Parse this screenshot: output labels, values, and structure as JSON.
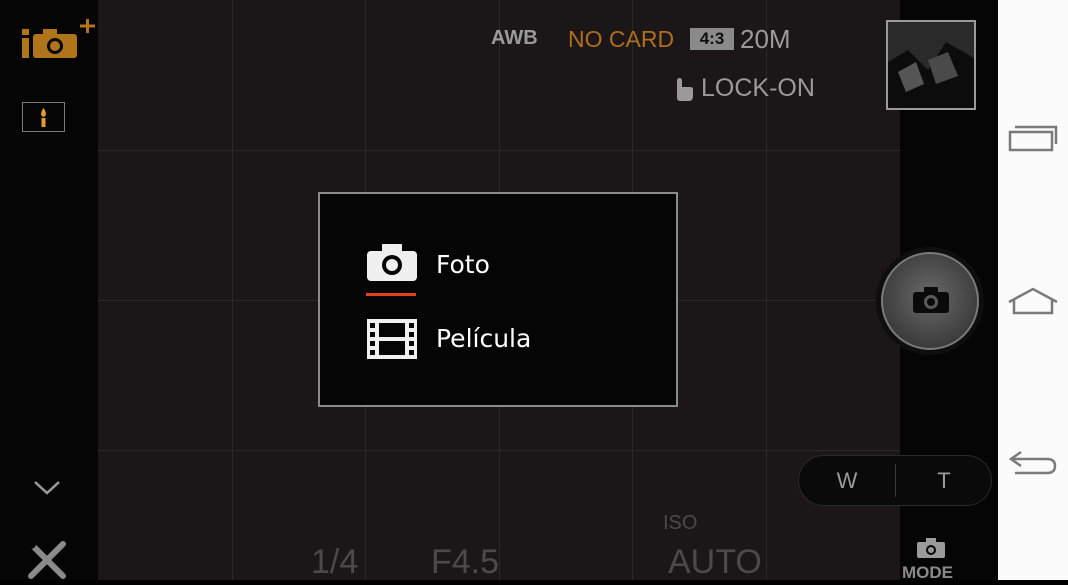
{
  "top_status": {
    "white_balance": "AWB",
    "storage": "NO CARD",
    "aspect_ratio": "4:3",
    "resolution": "20M",
    "touch_mode": "LOCK-ON"
  },
  "mode_dialog": {
    "items": [
      {
        "label": "Foto",
        "icon": "camera-icon",
        "selected": true
      },
      {
        "label": "Película",
        "icon": "film-icon",
        "selected": false
      }
    ]
  },
  "exposure": {
    "shutter_speed": "1/4",
    "aperture": "F4.5",
    "iso_label": "ISO",
    "iso_value": "AUTO"
  },
  "zoom": {
    "wide": "W",
    "tele": "T"
  },
  "mode_button": {
    "label": "MODE"
  },
  "colors": {
    "accent_orange": "#e07b1a",
    "no_card": "#b06d1d",
    "nav_bar": "#fbfbfb",
    "selected_underline": "#e0401a"
  }
}
